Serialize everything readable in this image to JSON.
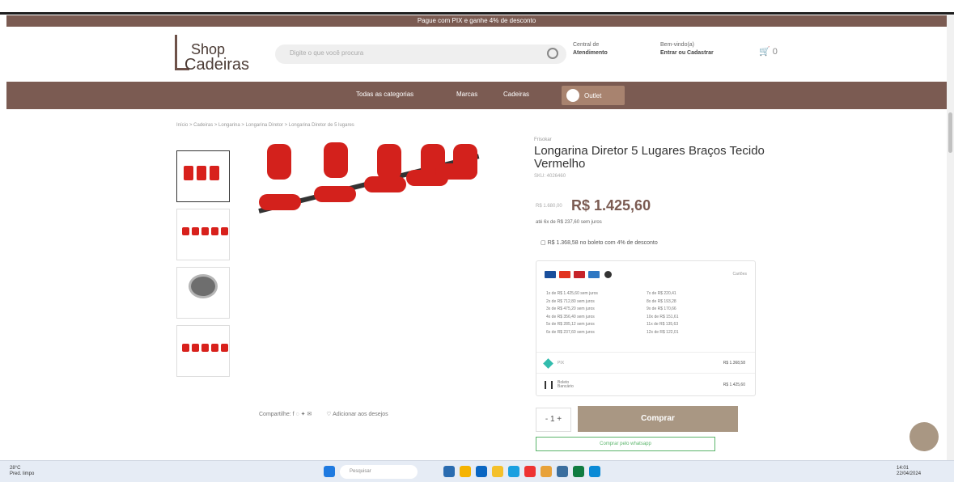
{
  "promo_text": "Pague com PIX e ganhe 4% de desconto",
  "header": {
    "logo_line1": "Shop",
    "logo_line2": "Cadeiras",
    "search_placeholder": "Digite o que você procura",
    "support_label": "Central de",
    "support_bold": "Atendimento",
    "account_label": "Bem-vindo(a)",
    "account_bold": "Entrar ou Cadastrar",
    "cart_count": "0"
  },
  "nav": {
    "items": [
      "Todas as categorias",
      "Marcas",
      "Cadeiras"
    ],
    "outlet": "Outlet"
  },
  "breadcrumb": "Início > Cadeiras > Longarina > Longarina Diretor > Longarina Diretor de 5 lugares",
  "product": {
    "brand": "Frisokar",
    "title": "Longarina Diretor 5 Lugares Braços Tecido Vermelho",
    "sku": "SKU: 4026460",
    "old_price": "R$ 1.680,00",
    "price": "R$ 1.425,60",
    "installments": "até 6x de R$ 237,60 sem juros",
    "boleto": "R$ 1.368,58 no boleto com 4% de desconto",
    "payment_toggle": "Cartões",
    "installment_rows_left": [
      "1x de R$ 1.425,60 sem juros",
      "2x de R$ 712,80 sem juros",
      "3x de R$ 475,20 sem juros",
      "4x de R$ 356,40 sem juros",
      "5x de R$ 285,12 sem juros",
      "6x de R$ 237,60 sem juros"
    ],
    "installment_rows_right": [
      "7x de R$ 220,41",
      "8x de R$ 193,28",
      "9x de R$ 170,66",
      "10x de R$ 151,61",
      "11x de R$ 135,63",
      "12x de R$ 122,01"
    ],
    "pix_label": "PIX",
    "pix_value": "R$ 1.368,58",
    "boleto_label": "Boleto Bancário",
    "boleto_value": "R$ 1.425,60",
    "quantity": "1",
    "buy_label": "Comprar",
    "whatsapp_label": "Comprar pelo whatsapp"
  },
  "share": {
    "label": "Compartilhe:",
    "wishlist": "Adicionar aos desejos"
  },
  "taskbar": {
    "weather_temp": "28°C",
    "weather_desc": "Pred. limpo",
    "search": "Pesquisar",
    "time": "14:01",
    "date": "22/04/2024"
  },
  "colors": {
    "brand": "#7b5b52",
    "buy": "#a99783",
    "accent_red": "#d3211c"
  }
}
